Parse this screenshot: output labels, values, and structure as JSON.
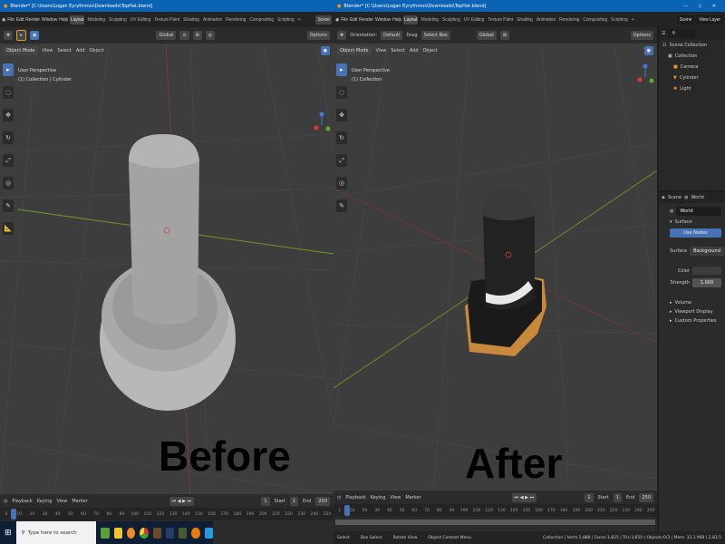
{
  "before": {
    "title": "Blender* [C:\\Users\\Logan Eyrythmos\\Downloads\\TopHat.blend]",
    "menus": [
      "File",
      "Edit",
      "Render",
      "Window",
      "Help"
    ],
    "workspaces": [
      "Layout",
      "Modeling",
      "Sculpting",
      "UV Editing",
      "Texture Paint",
      "Shading",
      "Animation",
      "Rendering",
      "Compositing",
      "Scripting",
      "+"
    ],
    "scene": "Scene",
    "orientation": "Global",
    "options": "Options",
    "mode": "Object Mode",
    "vp_menus": [
      "View",
      "Select",
      "Add",
      "Object"
    ],
    "view_name": "User Perspective",
    "collection": "(1) Collection | Cylinder",
    "label": "Before",
    "timeline_menus": [
      "Playback",
      "Keying",
      "View",
      "Marker"
    ],
    "frame": "1",
    "start_label": "Start",
    "start": "1",
    "end_label": "End",
    "end": "250",
    "ruler": [
      "0",
      "10",
      "20",
      "30",
      "40",
      "50",
      "60",
      "70",
      "80",
      "90",
      "100",
      "110",
      "120",
      "130",
      "140",
      "150",
      "160",
      "170",
      "180",
      "190",
      "200",
      "210",
      "220",
      "230",
      "240",
      "250"
    ],
    "search_placeholder": "Type here to search"
  },
  "after": {
    "title": "Blender* [C:\\Users\\Logan Eyrythmos\\Downloads\\TopHat.blend]",
    "menus": [
      "File",
      "Edit",
      "Render",
      "Window",
      "Help"
    ],
    "workspaces": [
      "Layout",
      "Modeling",
      "Sculpting",
      "UV Editing",
      "Texture Paint",
      "Shading",
      "Animation",
      "Rendering",
      "Compositing",
      "Scripting",
      "+"
    ],
    "scene": "Scene",
    "view_layer": "View Layer",
    "orientation_label": "Orientation:",
    "orientation": "Default",
    "drag_label": "Drag",
    "drag": "Select Box",
    "global": "Global",
    "options": "Options",
    "mode": "Object Mode",
    "vp_menus": [
      "View",
      "Select",
      "Add",
      "Object"
    ],
    "view_name": "User Perspective",
    "collection": "(1) Collection",
    "label": "After",
    "outliner": {
      "root": "Scene Collection",
      "collection": "Collection",
      "items": [
        "Camera",
        "Cylinder",
        "Light"
      ]
    },
    "props": {
      "tabs": [
        "Scene",
        "World"
      ],
      "world_name": "World",
      "surface": "Surface",
      "surface_btn": "Use Nodes",
      "surface_label": "Surface",
      "surface_val": "Background",
      "color_label": "Color",
      "strength_label": "Strength",
      "strength": "1.000",
      "sections": [
        "Volume",
        "Viewport Display",
        "Custom Properties"
      ]
    },
    "timeline_menus": [
      "Playback",
      "Keying",
      "View",
      "Marker"
    ],
    "frame": "1",
    "start_label": "Start",
    "start": "1",
    "end_label": "End",
    "end": "250",
    "ruler": [
      "1",
      "10",
      "20",
      "30",
      "40",
      "50",
      "60",
      "70",
      "80",
      "90",
      "100",
      "110",
      "120",
      "130",
      "140",
      "150",
      "160",
      "170",
      "180",
      "190",
      "200",
      "210",
      "220",
      "230",
      "240",
      "250"
    ],
    "status": [
      "Select",
      "Box Select",
      "Rotate View",
      "Object Context Menu"
    ],
    "stats": "Collection | Verts:1,888 | Faces:1,825 | Tris:3,650 | Objects:0/3 | Mem: 33.1 MiB | 2.83.5"
  }
}
